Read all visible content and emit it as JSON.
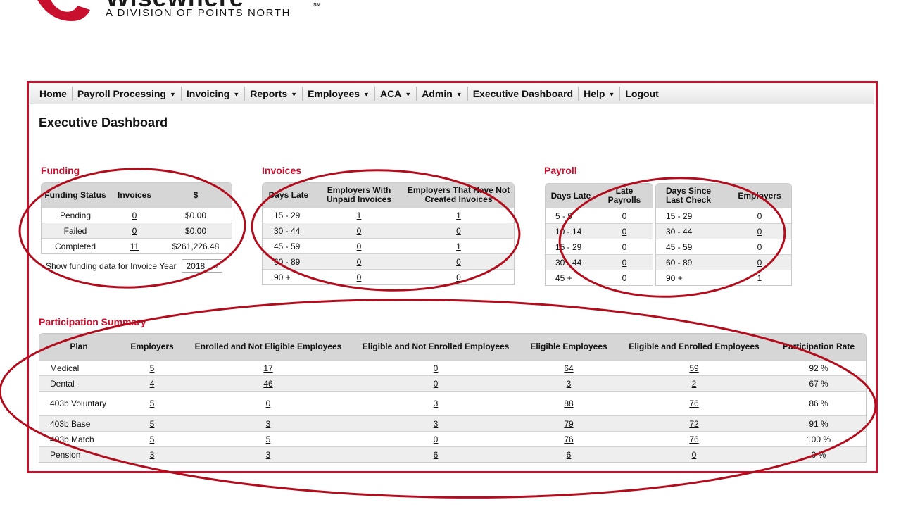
{
  "brand": {
    "name": "Wisewhere",
    "trademark": "SM",
    "subtitle": "A DIVISION OF POINTS NORTH",
    "color": "#c8102e"
  },
  "nav": [
    {
      "label": "Home",
      "caret": ""
    },
    {
      "label": "Payroll Processing",
      "caret": "▼"
    },
    {
      "label": "Invoicing",
      "caret": "▼"
    },
    {
      "label": "Reports",
      "caret": "▼"
    },
    {
      "label": "Employees",
      "caret": "▼"
    },
    {
      "label": "ACA",
      "caret": "▼"
    },
    {
      "label": "Admin",
      "caret": "▼"
    },
    {
      "label": "Executive Dashboard",
      "caret": ""
    },
    {
      "label": "Help",
      "caret": "▼"
    },
    {
      "label": "Logout",
      "caret": ""
    }
  ],
  "page_title": "Executive Dashboard",
  "funding": {
    "title": "Funding",
    "headers": [
      "Funding Status",
      "Invoices",
      "$"
    ],
    "rows": [
      {
        "status": "Pending",
        "invoices": "0",
        "amount": "$0.00"
      },
      {
        "status": "Failed",
        "invoices": "0",
        "amount": "$0.00"
      },
      {
        "status": "Completed",
        "invoices": "11",
        "amount": "$261,226.48"
      }
    ],
    "year_label": "Show funding data for Invoice Year",
    "year_value": "2018"
  },
  "invoices": {
    "title": "Invoices",
    "headers": [
      "Days Late",
      "Employers With Unpaid Invoices",
      "Employers That Have Not Created Invoices"
    ],
    "rows": [
      {
        "days": "15 - 29",
        "unpaid": "1",
        "not_created": "1"
      },
      {
        "days": "30 - 44",
        "unpaid": "0",
        "not_created": "0"
      },
      {
        "days": "45 - 59",
        "unpaid": "0",
        "not_created": "1"
      },
      {
        "days": "60 - 89",
        "unpaid": "0",
        "not_created": "0"
      },
      {
        "days": "90 +",
        "unpaid": "0",
        "not_created": "0"
      }
    ]
  },
  "payroll": {
    "title": "Payroll",
    "late": {
      "headers": [
        "Days Late",
        "Late Payrolls"
      ],
      "rows": [
        {
          "days": "5 - 9",
          "count": "0"
        },
        {
          "days": "10 - 14",
          "count": "0"
        },
        {
          "days": "15 - 29",
          "count": "0"
        },
        {
          "days": "30 - 44",
          "count": "0"
        },
        {
          "days": "45 +",
          "count": "0"
        }
      ]
    },
    "since_check": {
      "headers": [
        "Days Since Last Check",
        "Employers"
      ],
      "rows": [
        {
          "days": "15 - 29",
          "count": "0"
        },
        {
          "days": "30 - 44",
          "count": "0"
        },
        {
          "days": "45 - 59",
          "count": "0"
        },
        {
          "days": "60 - 89",
          "count": "0"
        },
        {
          "days": "90 +",
          "count": "1"
        }
      ]
    }
  },
  "participation": {
    "title": "Participation Summary",
    "headers": [
      "Plan",
      "Employers",
      "Enrolled and Not Eligible Employees",
      "Eligible and Not Enrolled Employees",
      "Eligible Employees",
      "Eligible and Enrolled Employees",
      "Participation Rate"
    ],
    "rows": [
      {
        "plan": "Medical",
        "employers": "5",
        "enrolled_not_eligible": "17",
        "eligible_not_enrolled": "0",
        "eligible": "64",
        "eligible_enrolled": "59",
        "rate": "92 %"
      },
      {
        "plan": "Dental",
        "employers": "4",
        "enrolled_not_eligible": "46",
        "eligible_not_enrolled": "0",
        "eligible": "3",
        "eligible_enrolled": "2",
        "rate": "67 %"
      },
      {
        "plan": "403b Voluntary",
        "employers": "5",
        "enrolled_not_eligible": "0",
        "eligible_not_enrolled": "3",
        "eligible": "88",
        "eligible_enrolled": "76",
        "rate": "86 %"
      },
      {
        "plan": "403b Base",
        "employers": "5",
        "enrolled_not_eligible": "3",
        "eligible_not_enrolled": "3",
        "eligible": "79",
        "eligible_enrolled": "72",
        "rate": "91 %"
      },
      {
        "plan": "403b Match",
        "employers": "5",
        "enrolled_not_eligible": "5",
        "eligible_not_enrolled": "0",
        "eligible": "76",
        "eligible_enrolled": "76",
        "rate": "100 %"
      },
      {
        "plan": "Pension",
        "employers": "3",
        "enrolled_not_eligible": "3",
        "eligible_not_enrolled": "6",
        "eligible": "6",
        "eligible_enrolled": "0",
        "rate": "0 %"
      }
    ]
  },
  "annotation_color": "#b30c1c"
}
